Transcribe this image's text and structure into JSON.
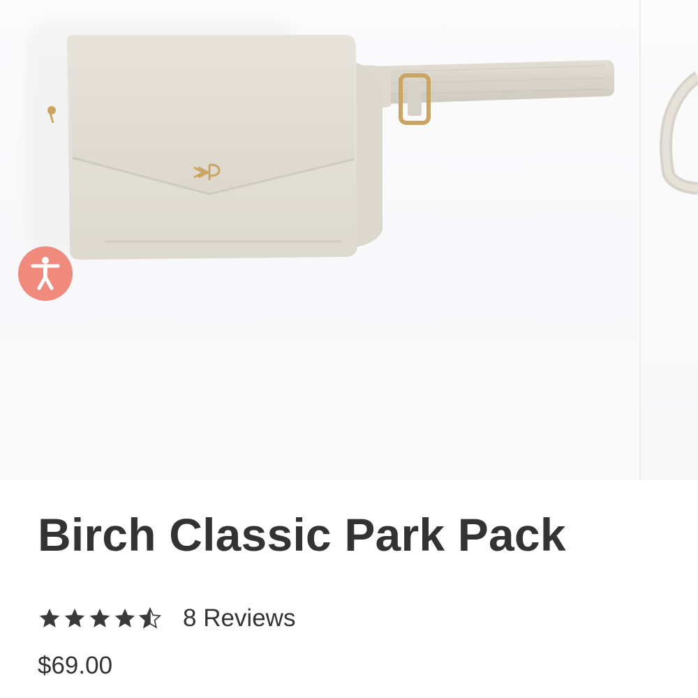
{
  "product": {
    "title": "Birch Classic Park Pack",
    "rating_value": 4.5,
    "rating_max": 5,
    "reviews_label": "8 Reviews",
    "price": "$69.00",
    "image_description_icon": "product-photo"
  },
  "accessibility": {
    "icon": "accessibility-person-icon",
    "color": "#ef8a7d"
  },
  "colors": {
    "text": "#333333",
    "star": "#3a3a3a",
    "bag": "#e4e0d7",
    "hardware": "#c9a462"
  }
}
